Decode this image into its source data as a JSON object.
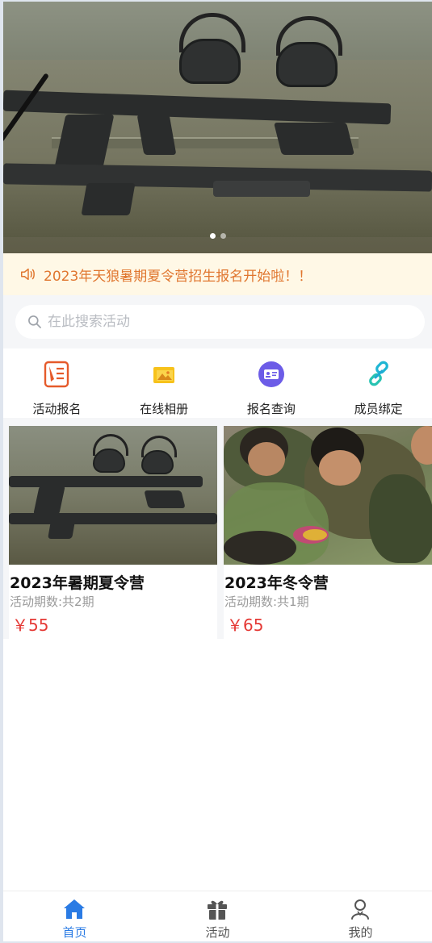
{
  "banner": {
    "slides": 2,
    "active_slide": 1
  },
  "notice": {
    "text": "2023年天狼暑期夏令营招生报名开始啦！！"
  },
  "search": {
    "placeholder": "在此搜索活动"
  },
  "nav": [
    {
      "label": "活动报名",
      "icon": "form-pen-icon"
    },
    {
      "label": "在线相册",
      "icon": "photo-album-icon"
    },
    {
      "label": "报名查询",
      "icon": "id-card-icon"
    },
    {
      "label": "成员绑定",
      "icon": "link-icon"
    }
  ],
  "cards": [
    {
      "title": "2023年暑期夏令营",
      "period": "活动期数:共2期",
      "price": "￥55"
    },
    {
      "title": "2023年冬令营",
      "period": "活动期数:共1期",
      "price": "￥65"
    }
  ],
  "tabbar": [
    {
      "label": "首页",
      "icon": "home-icon",
      "active": true
    },
    {
      "label": "活动",
      "icon": "gift-icon",
      "active": false
    },
    {
      "label": "我的",
      "icon": "user-icon",
      "active": false
    }
  ],
  "colors": {
    "accent": "#2a7be4",
    "notice_text": "#e0762f",
    "price": "#e53935"
  }
}
